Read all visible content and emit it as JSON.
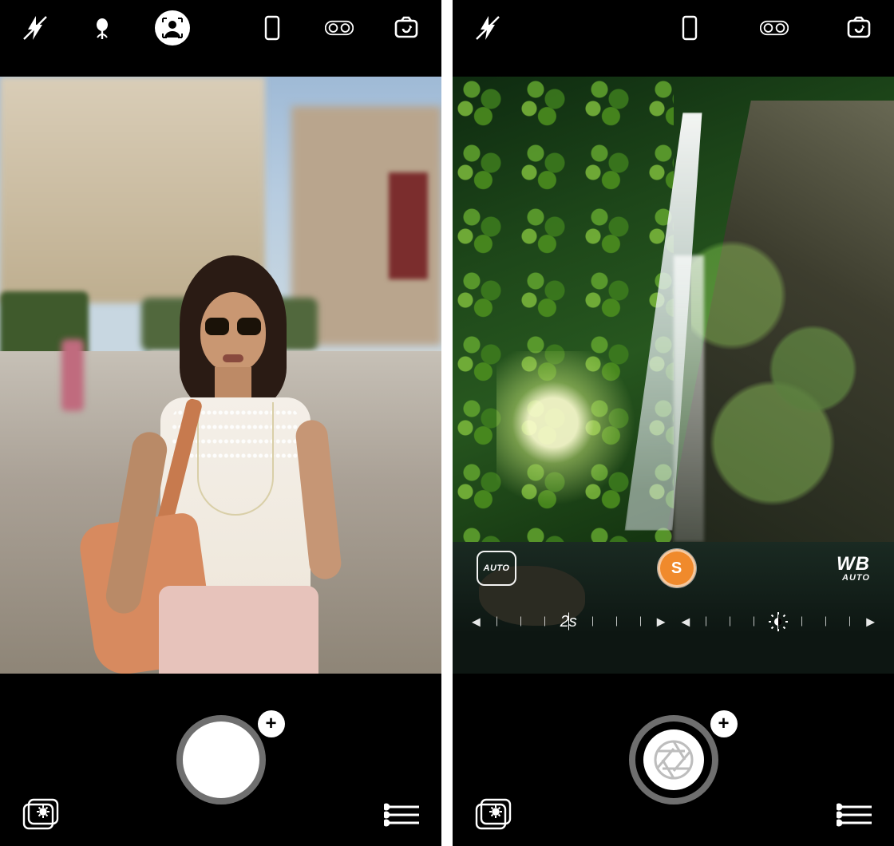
{
  "left": {
    "top_icons": [
      "flash-off",
      "macro",
      "portrait",
      "device",
      "dual-lens",
      "switch-camera"
    ],
    "plus": "+"
  },
  "right": {
    "top_icons": [
      "flash-off",
      "device",
      "dual-lens",
      "switch-camera"
    ],
    "mid": {
      "focus_label": "AUTO",
      "shutter_priority_letter": "S",
      "wb_label": "WB",
      "wb_mode": "AUTO"
    },
    "sliders": {
      "shutter_speed": "2s"
    },
    "plus": "+"
  }
}
